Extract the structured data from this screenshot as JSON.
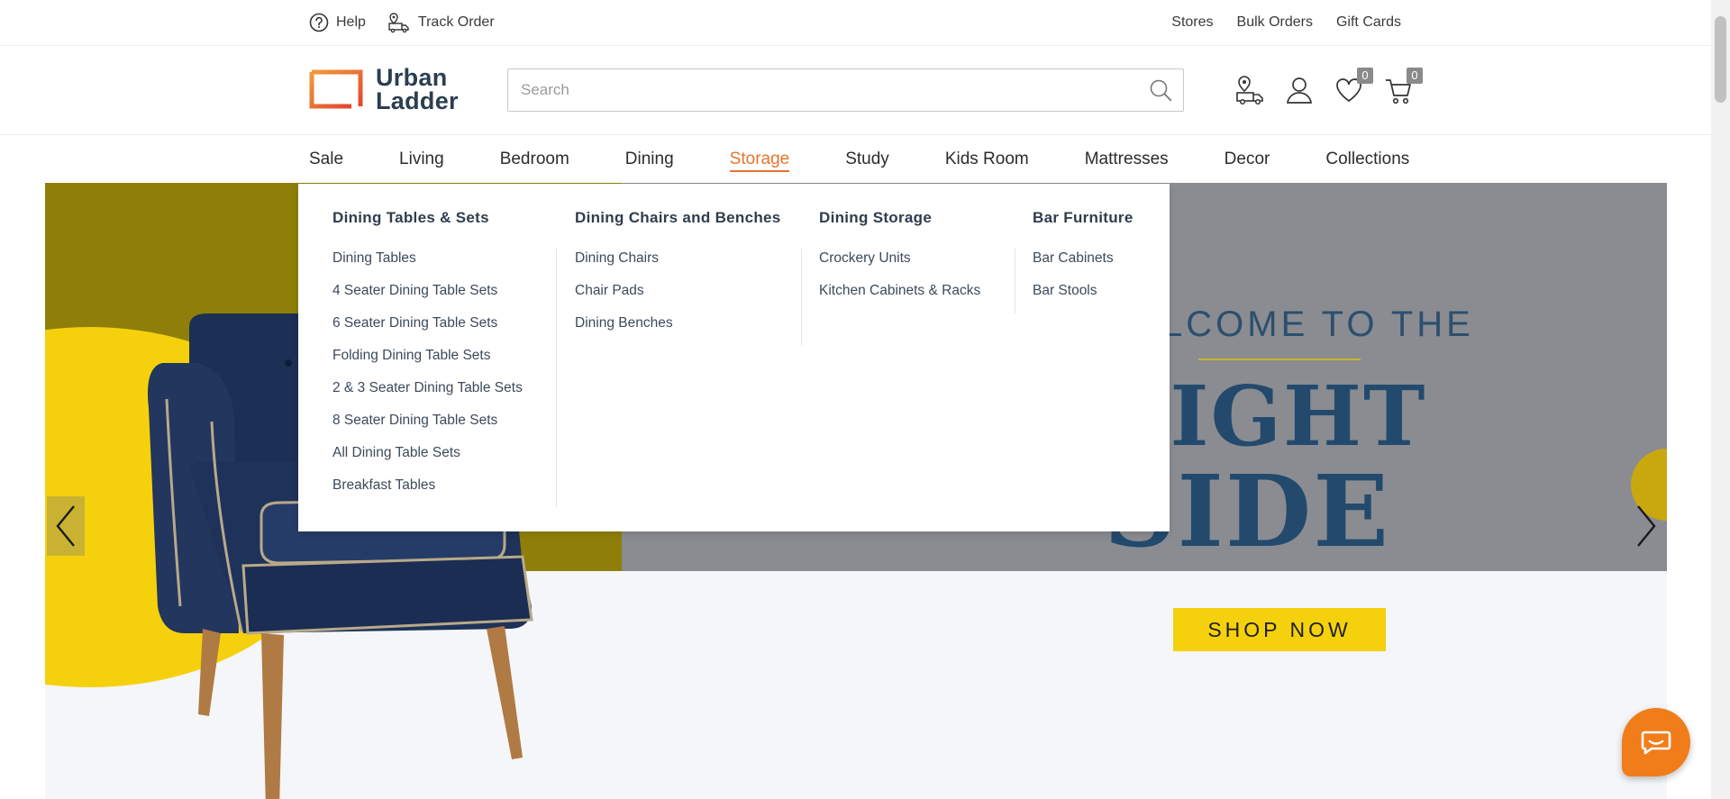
{
  "topbar": {
    "left": [
      {
        "icon": "help-circle-icon",
        "label": "Help"
      },
      {
        "icon": "track-order-icon",
        "label": "Track Order"
      }
    ],
    "right": [
      "Stores",
      "Bulk Orders",
      "Gift Cards"
    ]
  },
  "header": {
    "logo_line1": "Urban",
    "logo_line2": "Ladder",
    "search_placeholder": "Search",
    "wishlist_count": "0",
    "cart_count": "0"
  },
  "nav": {
    "items": [
      "Sale",
      "Living",
      "Bedroom",
      "Dining",
      "Storage",
      "Study",
      "Kids Room",
      "Mattresses",
      "Decor",
      "Collections"
    ],
    "active": "Storage"
  },
  "megamenu": {
    "columns": [
      {
        "title": "Dining Tables & Sets",
        "links": [
          "Dining Tables",
          "4 Seater Dining Table Sets",
          "6 Seater Dining Table Sets",
          "Folding Dining Table Sets",
          "2 & 3 Seater Dining Table Sets",
          "8 Seater Dining Table Sets",
          "All Dining Table Sets",
          "Breakfast Tables"
        ]
      },
      {
        "title": "Dining Chairs and Benches",
        "links": [
          "Dining Chairs",
          "Chair Pads",
          "Dining Benches"
        ]
      },
      {
        "title": "Dining Storage",
        "links": [
          "Crockery Units",
          "Kitchen Cabinets & Racks"
        ]
      },
      {
        "title": "Bar Furniture",
        "links": [
          "Bar Cabinets",
          "Bar Stools"
        ]
      }
    ]
  },
  "hero": {
    "welcome": "LCOME TO THE",
    "bright": "RIGHT",
    "side": "SIDE",
    "cta": "SHOP NOW"
  },
  "colors": {
    "accent": "#e8732e",
    "cta": "#f5d10d",
    "chat": "#f07d1a",
    "headline": "#234a6d"
  }
}
